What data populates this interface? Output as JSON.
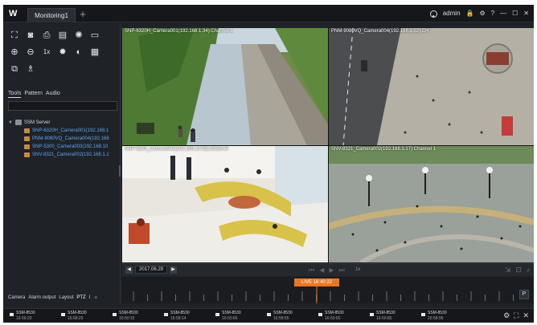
{
  "app": {
    "logo": "W",
    "tab_label": "Monitoring1",
    "tab_add": "+",
    "user_label": "admin",
    "icons": {
      "lock": "🔒",
      "gear": "⚙",
      "help": "?",
      "minimize": "—",
      "maximize": "☐",
      "close": "✕"
    }
  },
  "toolbar": {
    "rows": [
      [
        {
          "name": "fullscreen-icon",
          "glyph": "⛶"
        },
        {
          "name": "camera-icon",
          "glyph": "◙"
        },
        {
          "name": "printer-icon",
          "glyph": "⎙"
        },
        {
          "name": "record-icon",
          "glyph": "▤"
        },
        {
          "name": "alarm-icon",
          "glyph": "✺"
        },
        {
          "name": "monitor-icon",
          "glyph": "▭"
        }
      ],
      [
        {
          "name": "zoom-in-icon",
          "glyph": "⊕"
        },
        {
          "name": "zoom-out-icon",
          "glyph": "⊖"
        },
        {
          "name": "ratio-1x-icon",
          "glyph": "1x"
        },
        {
          "name": "brightness-icon",
          "glyph": "✹"
        },
        {
          "name": "contrast-icon",
          "glyph": "◐"
        },
        {
          "name": "layout-grid-icon",
          "glyph": "▦"
        }
      ],
      [
        {
          "name": "copy-icon",
          "glyph": "⧉"
        },
        {
          "name": "tree-icon",
          "glyph": "♗"
        }
      ]
    ]
  },
  "panel_tabs": [
    "Tools",
    "Pattern",
    "Audio"
  ],
  "tree": {
    "root": "SSM Server",
    "cameras": [
      "SNP-6320H_Camera001(192.168.1",
      "PNM-9080VQ_Camera004(192.168",
      "SNP-5300_Camera003(192.168.10",
      "SNV-8321_Camera002(192.168.1.1"
    ]
  },
  "bottom_tabs": [
    "Camera",
    "Alarm output",
    "Layout",
    "PTZ",
    "I",
    "☼"
  ],
  "tiles": [
    {
      "label": "SNP-6320H_Camera001(192.168.1.34):Channel 1"
    },
    {
      "label": "PNM-9080VQ_Camera004(192.168.1.52):CH"
    },
    {
      "label": "SNP-5300_Camera003(192.168.10.93):Channel"
    },
    {
      "label": "SNV-8321_Camera002(192.168.1.17):Channel 1"
    }
  ],
  "playback": {
    "prev": "◀",
    "date": "2017.06.29",
    "next": "▶",
    "speed": "1x",
    "transport": [
      "⏮",
      "◀",
      "▶",
      "⏭"
    ],
    "right_icons": [
      "⇲",
      "⊡",
      "⌕"
    ]
  },
  "timeline": {
    "live_label": "LIVE 16:40:22",
    "end_button": "P"
  },
  "status": [
    {
      "name": "SSM-8530",
      "time": "16:59:29"
    },
    {
      "name": "SSM-8530",
      "time": "16:58:29"
    },
    {
      "name": "SSM-8530",
      "time": "16:50:15"
    },
    {
      "name": "SSM-8530",
      "time": "16:58:14"
    },
    {
      "name": "SSM-8530",
      "time": "16:50:65"
    },
    {
      "name": "SSM-8530",
      "time": "16:58:65"
    },
    {
      "name": "SSM-8530",
      "time": "16:50:65"
    },
    {
      "name": "SSM-8530",
      "time": "16:50:85"
    },
    {
      "name": "SSM-8530",
      "time": "16:58:95"
    }
  ],
  "status_icons": [
    "⚙",
    "⛶",
    "✕"
  ]
}
